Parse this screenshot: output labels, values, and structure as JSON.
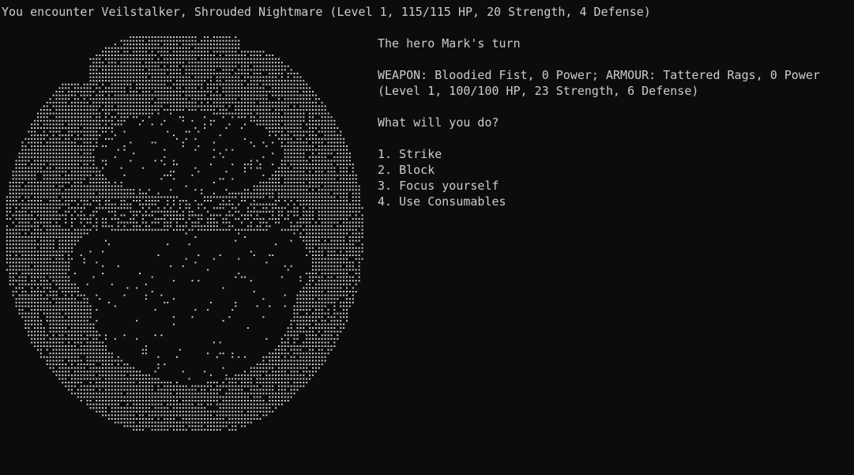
{
  "encounter_text": "You encounter Veilstalker, Shrouded Nightmare (Level 1, 115/115 HP, 20 Strength, 4 Defense)",
  "turn_text": "The hero Mark's turn",
  "equipment_text": "WEAPON: Bloodied Fist, 0 Power; ARMOUR: Tattered Rags, 0 Power",
  "stats_text": "(Level 1, 100/100 HP, 23 Strength, 6 Defense)",
  "prompt_text": "What will you do?",
  "options": [
    {
      "label": "1. Strike"
    },
    {
      "label": "2. Block"
    },
    {
      "label": "3. Focus yourself"
    },
    {
      "label": "4. Use Consumables"
    }
  ],
  "colors": {
    "background": "#0c0c0c",
    "text": "#cccccc"
  }
}
